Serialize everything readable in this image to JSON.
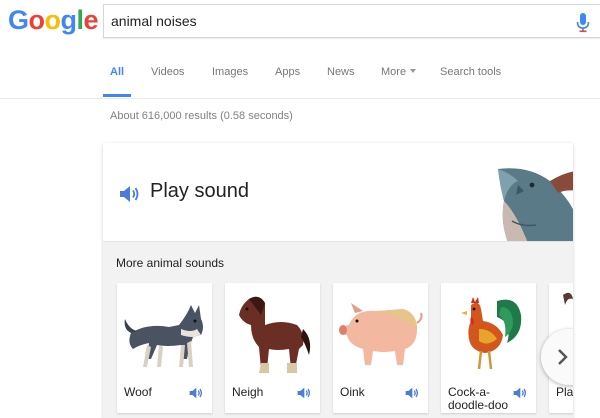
{
  "search": {
    "query": "animal noises"
  },
  "logo": {
    "text": "Google"
  },
  "tabs": [
    {
      "label": "All",
      "active": true
    },
    {
      "label": "Videos"
    },
    {
      "label": "Images"
    },
    {
      "label": "Apps"
    },
    {
      "label": "News"
    },
    {
      "label": "More"
    },
    {
      "label": "Search tools"
    }
  ],
  "results": {
    "stats": "About 616,000 results (0.58 seconds)"
  },
  "card": {
    "play_label": "Play sound",
    "more_title": "More animal sounds",
    "animals": [
      {
        "name": "Woof"
      },
      {
        "name": "Neigh"
      },
      {
        "name": "Oink"
      },
      {
        "name": "Cock-a-doodle-doo"
      },
      {
        "name": "Pla"
      }
    ]
  },
  "colors": {
    "accent": "#4285f4",
    "speaker": "#4c7bd9"
  },
  "icons": [
    "mic-icon",
    "speaker-icon",
    "chevron-right-icon",
    "caret-down-icon"
  ]
}
